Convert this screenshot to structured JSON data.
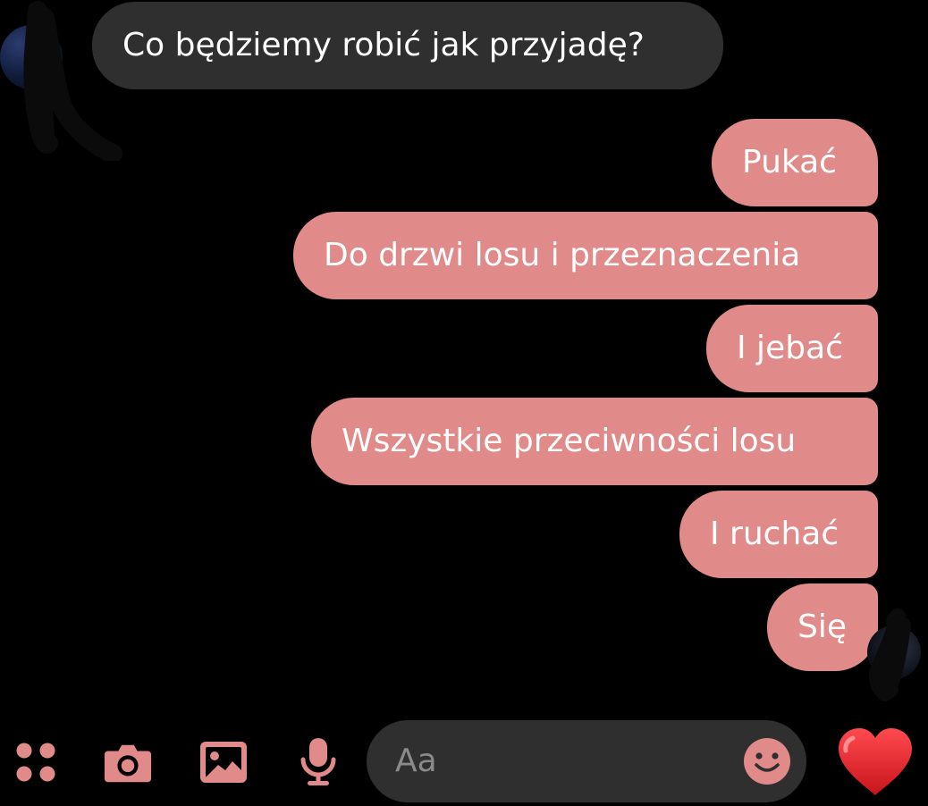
{
  "conversation": {
    "messages": [
      {
        "direction": "incoming",
        "text": "Co będziemy robić jak przyjadę?"
      },
      {
        "direction": "outgoing",
        "text": "Pukać"
      },
      {
        "direction": "outgoing",
        "text": "Do drzwi losu i przeznaczenia"
      },
      {
        "direction": "outgoing",
        "text": "I jebać"
      },
      {
        "direction": "outgoing",
        "text": "Wszystkie przeciwności losu"
      },
      {
        "direction": "outgoing",
        "text": "I ruchać"
      },
      {
        "direction": "outgoing",
        "text": "Się"
      }
    ]
  },
  "composer": {
    "placeholder": "Aa",
    "icons": {
      "menu": "apps-grid-icon",
      "camera": "camera-icon",
      "gallery": "image-icon",
      "mic": "microphone-icon",
      "emoji": "emoji-icon",
      "send": "heart-icon"
    }
  },
  "colors": {
    "background": "#000000",
    "incoming_bubble": "#2f2f2f",
    "outgoing_bubble": "#e08a89",
    "accent": "#e08a89",
    "heart": "#e8262c",
    "text": "#ffffff",
    "placeholder": "#8a8a8a"
  }
}
